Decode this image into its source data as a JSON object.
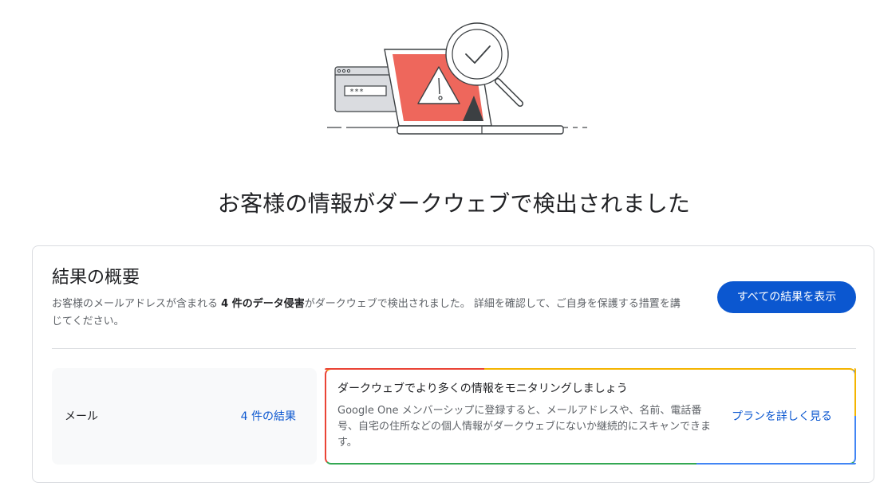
{
  "page": {
    "title": "お客様の情報がダークウェブで検出されました"
  },
  "summary": {
    "title": "結果の概要",
    "description_prefix": "お客様のメールアドレスが含まれる ",
    "description_bold": "4 件のデータ侵害",
    "description_suffix": "がダークウェブで検出されました。 詳細を確認して、ご自身を保護する措置を講じてください。",
    "view_all_label": "すべての結果を表示"
  },
  "email_result": {
    "label": "メール",
    "results_link": "4 件の結果"
  },
  "promo": {
    "title": "ダークウェブでより多くの情報をモニタリングしましょう",
    "description": "Google One メンバーシップに登録すると、メールアドレスや、名前、電話番号、自宅の住所などの個人情報がダークウェブにないか継続的にスキャンできます。",
    "link_label": "プランを詳しく見る"
  },
  "illustration": {
    "password_mask": "***",
    "colors": {
      "screen": "#ee675c",
      "outline": "#3c4043",
      "card": "#dadce0"
    }
  }
}
